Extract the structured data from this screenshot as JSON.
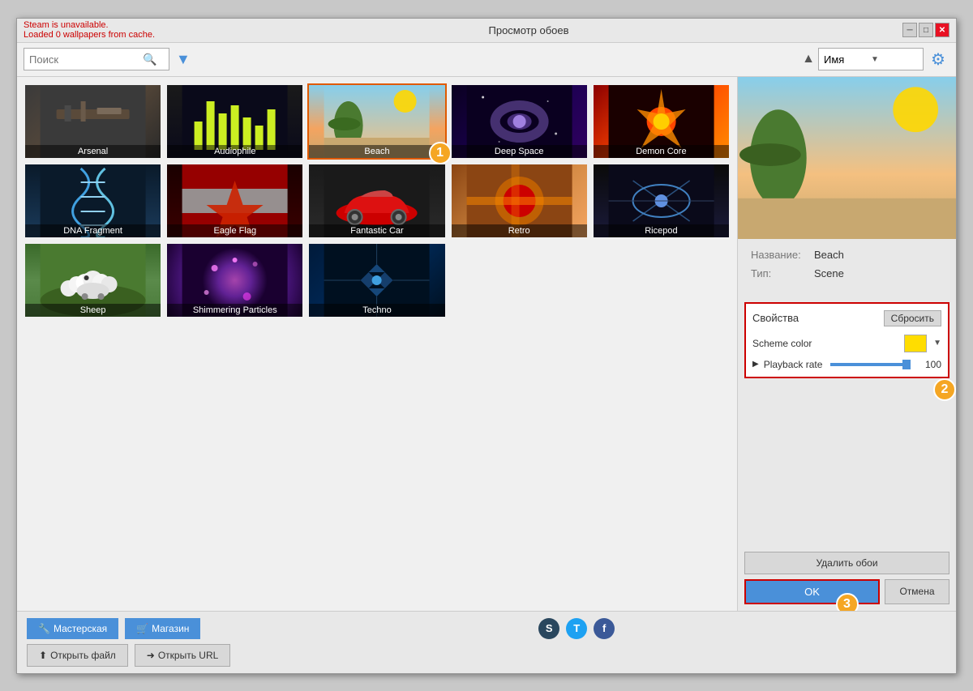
{
  "window": {
    "title": "Просмотр обоев",
    "status_line1": "Steam is unavailable.",
    "status_line2": "Loaded 0 wallpapers from cache."
  },
  "toolbar": {
    "search_placeholder": "Поиск",
    "sort_label": "Имя"
  },
  "grid": {
    "items": [
      {
        "id": "arsenal",
        "label": "Arsenal",
        "theme": "arsenal"
      },
      {
        "id": "audiophile",
        "label": "Audiophile",
        "theme": "audiophile"
      },
      {
        "id": "beach",
        "label": "Beach",
        "theme": "beach",
        "selected": true
      },
      {
        "id": "deepspace",
        "label": "Deep Space",
        "theme": "deepspace"
      },
      {
        "id": "demoncore",
        "label": "Demon Core",
        "theme": "demoncore"
      },
      {
        "id": "dnafragment",
        "label": "DNA Fragment",
        "theme": "dnafragment"
      },
      {
        "id": "eagleflag",
        "label": "Eagle Flag",
        "theme": "eagleflag"
      },
      {
        "id": "fantasticcar",
        "label": "Fantastic Car",
        "theme": "fantasticcar"
      },
      {
        "id": "retro",
        "label": "Retro",
        "theme": "retro"
      },
      {
        "id": "ricepod",
        "label": "Ricepod",
        "theme": "ricepod"
      },
      {
        "id": "sheep",
        "label": "Sheep",
        "theme": "sheep"
      },
      {
        "id": "shimmer",
        "label": "Shimmering Particles",
        "theme": "shimmer"
      },
      {
        "id": "techno",
        "label": "Techno",
        "theme": "techno"
      }
    ]
  },
  "preview": {
    "name_label": "Название:",
    "name_value": "Beach",
    "type_label": "Тип:",
    "type_value": "Scene"
  },
  "properties": {
    "title": "Свойства",
    "reset_label": "Сбросить",
    "scheme_color_label": "Scheme color",
    "playback_label": "Playback rate",
    "playback_value": "100"
  },
  "bottom": {
    "workshop_label": "Мастерская",
    "shop_label": "Магазин",
    "open_file_label": "Открыть файл",
    "open_url_label": "Открыть URL",
    "delete_label": "Удалить обои",
    "ok_label": "OK",
    "cancel_label": "Отмена"
  },
  "badges": {
    "b1": "1",
    "b2": "2",
    "b3": "3"
  }
}
